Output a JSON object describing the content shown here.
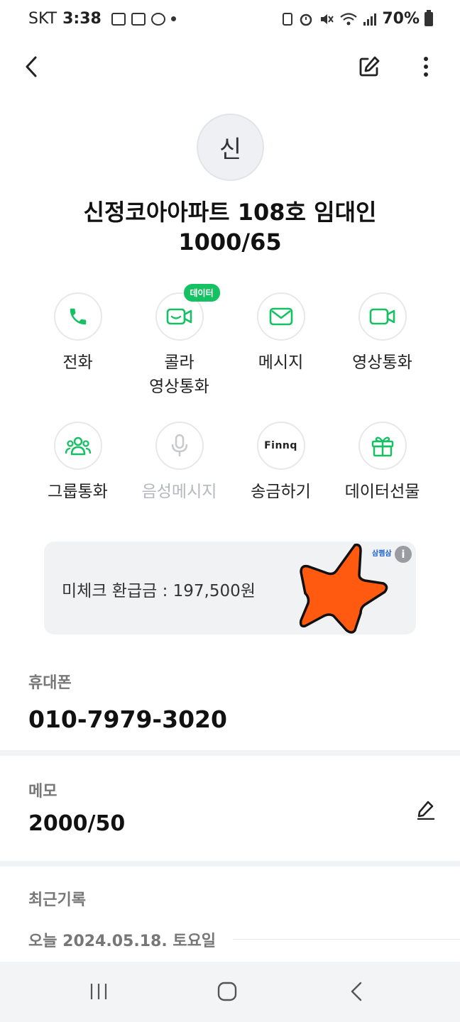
{
  "status_bar": {
    "carrier": "SKT",
    "time": "3:38",
    "battery": "70%"
  },
  "contact": {
    "avatar_initial": "신",
    "name_line1": "신정코아아파트 108호 임대인",
    "name_line2": "1000/65"
  },
  "actions": [
    {
      "label": "전화",
      "icon": "phone-icon",
      "enabled": true
    },
    {
      "label": "콜라\n영상통화",
      "icon": "video-call-icon",
      "enabled": true,
      "badge": "데이터"
    },
    {
      "label": "메시지",
      "icon": "mail-icon",
      "enabled": true
    },
    {
      "label": "영상통화",
      "icon": "camera-icon",
      "enabled": true
    },
    {
      "label": "그룹통화",
      "icon": "group-icon",
      "enabled": true
    },
    {
      "label": "음성메시지",
      "icon": "microphone-icon",
      "enabled": false
    },
    {
      "label": "송금하기",
      "icon": "finnq-logo",
      "icon_text": "Finnq",
      "enabled": true
    },
    {
      "label": "데이터선물",
      "icon": "gift-icon",
      "enabled": true
    }
  ],
  "refund_card": {
    "text": "미체크 환급금 : 197,500원",
    "brand": "삼쩜삼",
    "info": "i"
  },
  "phone_section": {
    "label": "휴대폰",
    "value": "010-7979-3020"
  },
  "memo_section": {
    "label": "메모",
    "value": "2000/50"
  },
  "recent_section": {
    "label": "최근기록",
    "date": "오늘 2024.05.18. 토요일"
  },
  "colors": {
    "accent_green": "#16c163",
    "star_orange": "#ff5a10",
    "disabled_gray": "#b5b8bd"
  }
}
